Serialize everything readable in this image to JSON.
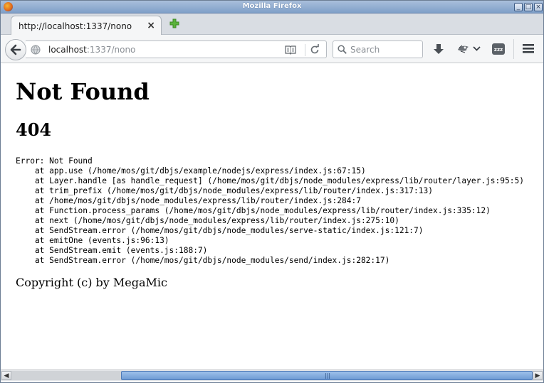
{
  "window": {
    "title": "Mozilla Firefox"
  },
  "tab": {
    "title": "http://localhost:1337/nono",
    "close": "×"
  },
  "navbar": {
    "url_host": "localhost",
    "url_path": ":1337/nono",
    "search_placeholder": "Search"
  },
  "page": {
    "heading": "Not Found",
    "status_code": "404",
    "stack_trace": "Error: Not Found\n    at app.use (/home/mos/git/dbjs/example/nodejs/express/index.js:67:15)\n    at Layer.handle [as handle_request] (/home/mos/git/dbjs/node_modules/express/lib/router/layer.js:95:5)\n    at trim_prefix (/home/mos/git/dbjs/node_modules/express/lib/router/index.js:317:13)\n    at /home/mos/git/dbjs/node_modules/express/lib/router/index.js:284:7\n    at Function.process_params (/home/mos/git/dbjs/node_modules/express/lib/router/index.js:335:12)\n    at next (/home/mos/git/dbjs/node_modules/express/lib/router/index.js:275:10)\n    at SendStream.error (/home/mos/git/dbjs/node_modules/serve-static/index.js:121:7)\n    at emitOne (events.js:96:13)\n    at SendStream.emit (events.js:188:7)\n    at SendStream.error (/home/mos/git/dbjs/node_modules/send/index.js:282:17)",
    "copyright": "Copyright (c) by MegaMic"
  },
  "icons": {
    "app": "firefox-icon",
    "new_tab": "plus-icon",
    "back": "back-arrow-icon",
    "site": "globe-icon",
    "reader": "reader-view-icon",
    "reload": "reload-icon",
    "search": "search-icon",
    "downloads": "download-icon",
    "addon": "addon-icon",
    "addon_menu": "chevron-down-icon",
    "sleep": "zzz-icon",
    "menu": "hamburger-menu-icon"
  },
  "scrollbar": {
    "position": 0.29
  }
}
